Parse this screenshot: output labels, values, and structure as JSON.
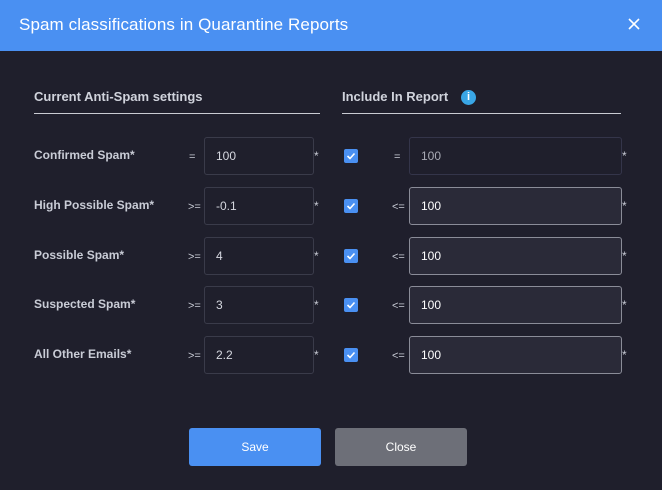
{
  "dialog": {
    "title": "Spam classifications in Quarantine Reports",
    "close_icon": "close-icon"
  },
  "sections": {
    "left_heading": "Current Anti-Spam settings",
    "right_heading": "Include In Report",
    "info_icon": "info-icon",
    "info_glyph": "i"
  },
  "rows": [
    {
      "label": "Confirmed Spam*",
      "op": "=",
      "value": "100",
      "star": "*",
      "checked": true,
      "report_op": "=",
      "report_value": "100",
      "report_star": "*"
    },
    {
      "label": "High Possible Spam*",
      "op": ">=",
      "value": "-0.1",
      "star": "*",
      "checked": true,
      "report_op": "<=",
      "report_value": "100",
      "report_star": "*"
    },
    {
      "label": "Possible Spam*",
      "op": ">=",
      "value": "4",
      "star": "*",
      "checked": true,
      "report_op": "<=",
      "report_value": "100",
      "report_star": "*"
    },
    {
      "label": "Suspected Spam*",
      "op": ">=",
      "value": "3",
      "star": "*",
      "checked": true,
      "report_op": "<=",
      "report_value": "100",
      "report_star": "*"
    },
    {
      "label": "All Other Emails*",
      "op": ">=",
      "value": "2.2",
      "star": "*",
      "checked": true,
      "report_op": "<=",
      "report_value": "100",
      "report_star": "*"
    }
  ],
  "buttons": {
    "save": "Save",
    "close": "Close"
  },
  "colors": {
    "header_bg": "#4a90f2",
    "dialog_bg": "#1f1f2c",
    "checkbox": "#4a90f2",
    "info": "#39a6e6",
    "close_button": "#6d6f78"
  }
}
